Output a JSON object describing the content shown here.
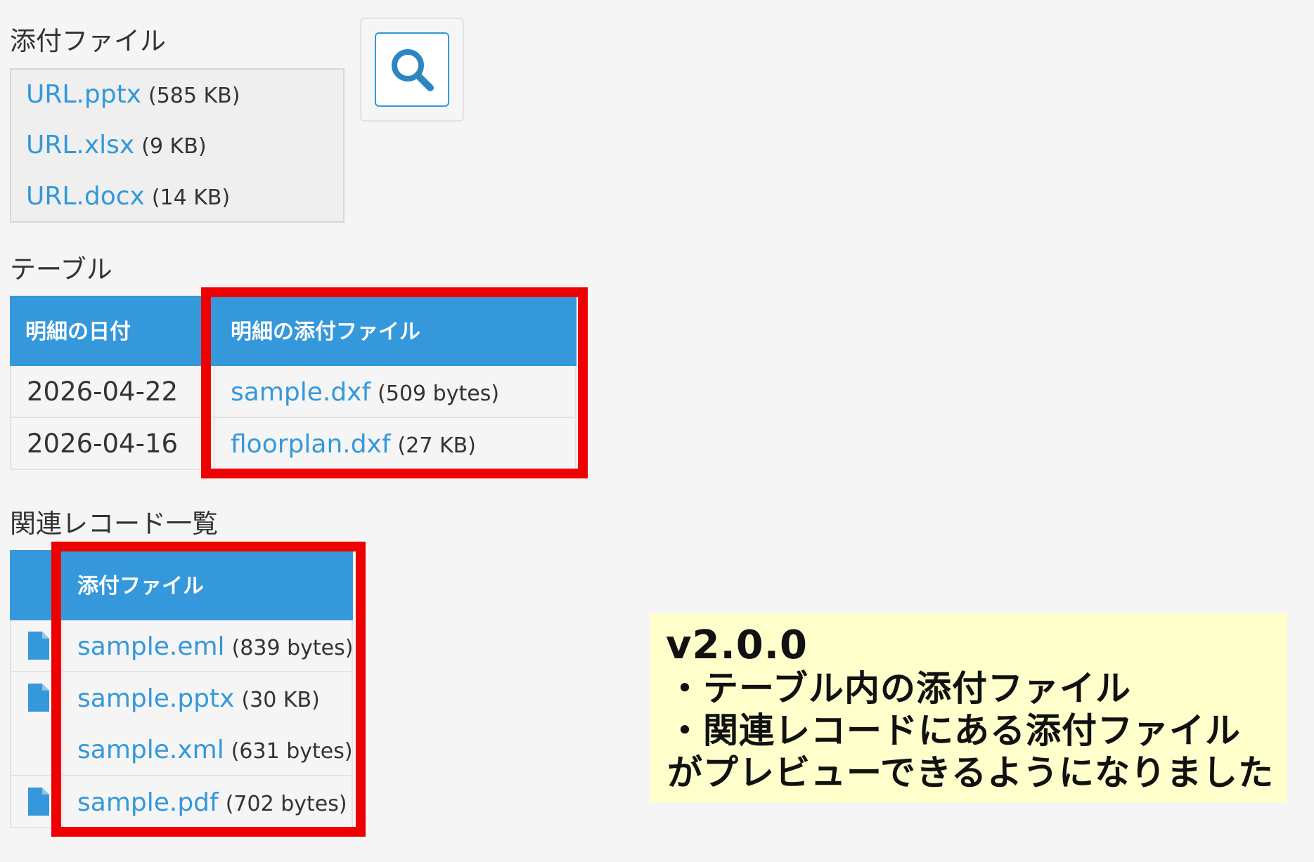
{
  "attachments": {
    "label": "添付ファイル",
    "files": [
      {
        "name": "URL.pptx",
        "size": "(585 KB)"
      },
      {
        "name": "URL.xlsx",
        "size": "(9 KB)"
      },
      {
        "name": "URL.docx",
        "size": "(14 KB)"
      }
    ],
    "search_icon": "search-icon"
  },
  "table": {
    "label": "テーブル",
    "headers": [
      "明細の日付",
      "明細の添付ファイル"
    ],
    "rows": [
      {
        "date": "2026-04-22",
        "file": "sample.dxf",
        "size": "(509 bytes)"
      },
      {
        "date": "2026-04-16",
        "file": "floorplan.dxf",
        "size": "(27 KB)"
      }
    ]
  },
  "related": {
    "label": "関連レコード一覧",
    "header": "添付ファイル",
    "files": [
      {
        "name": "sample.eml",
        "size": "(839 bytes)"
      },
      {
        "name": "sample.pptx",
        "size": "(30 KB)"
      },
      {
        "name": "sample.xml",
        "size": "(631 bytes)"
      },
      {
        "name": "sample.pdf",
        "size": "(702 bytes)"
      }
    ],
    "record_icon": "document-icon"
  },
  "note": {
    "version": "v2.0.0",
    "lines": [
      "・テーブル内の添付ファイル",
      "・関連レコードにある添付ファイル",
      "がプレビューできるようになりました"
    ]
  },
  "colors": {
    "accent": "#3498db",
    "highlight": "#ee0000",
    "note_bg": "#ffffcc"
  }
}
